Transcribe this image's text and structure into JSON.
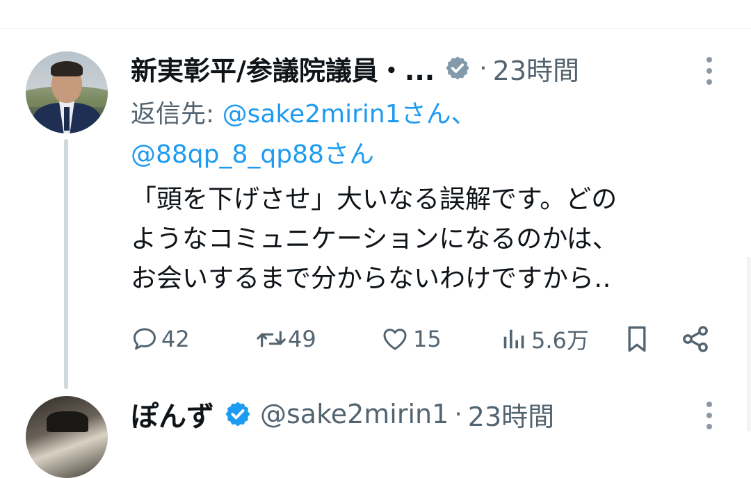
{
  "tweet": {
    "author_name": "新実彰平/参議院議員・...",
    "separator": "·",
    "time": "23時間",
    "reply_prefix": "返信先: ",
    "reply_handle_1": "@sake2mirin1さん、",
    "reply_handle_2": "@88qp_8_qp88さん",
    "text": "「頭を下げさせ」大いなる誤解です。どの\nようなコミュニケーションになるのかは、\nお会いするまで分からないわけですから‥",
    "stats": {
      "replies": "42",
      "retweets": "49",
      "likes": "15",
      "views": "5.6万"
    }
  },
  "next_tweet": {
    "author_name": "ぽんず",
    "handle": "@sake2mirin1",
    "separator": "·",
    "time": "23時間"
  },
  "colors": {
    "link": "#1d9bf0",
    "muted": "#536471",
    "verified_gray": "#829aab",
    "verified_blue": "#1d9bf0",
    "thread_line": "#cfd9de"
  },
  "icons": {
    "reply": "speech-bubble-icon",
    "retweet": "retweet-arrows-icon",
    "like": "heart-icon",
    "views": "bar-chart-icon",
    "bookmark": "bookmark-icon",
    "share": "share-nodes-icon",
    "more": "vertical-dots-icon",
    "verified": "verified-badge-icon"
  }
}
